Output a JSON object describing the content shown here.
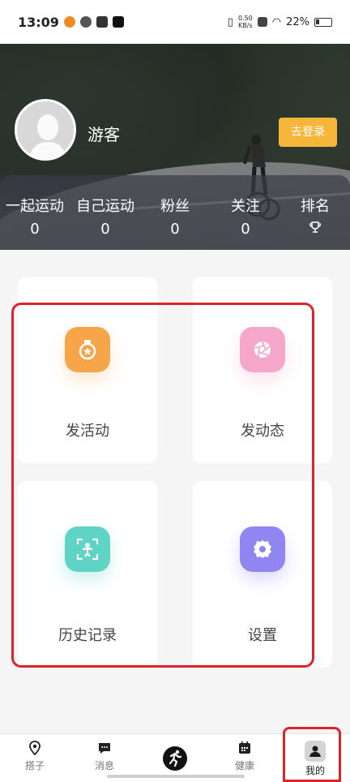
{
  "status_bar": {
    "time": "13:09",
    "net_speed_value": "0.50",
    "net_speed_unit": "KB/s",
    "battery": "22%"
  },
  "profile": {
    "username": "游客",
    "login_button": "去登录"
  },
  "stats": [
    {
      "label": "一起运动",
      "value": "0"
    },
    {
      "label": "自己运动",
      "value": "0"
    },
    {
      "label": "粉丝",
      "value": "0"
    },
    {
      "label": "关注",
      "value": "0"
    },
    {
      "label": "排名",
      "value": ""
    }
  ],
  "cards": [
    {
      "label": "发活动",
      "icon": "medal-icon",
      "color": "#f7a54a"
    },
    {
      "label": "发动态",
      "icon": "aperture-icon",
      "color": "#f4a7c8"
    },
    {
      "label": "历史记录",
      "icon": "person-scan-icon",
      "color": "#5ed3c6"
    },
    {
      "label": "设置",
      "icon": "gear-icon",
      "color": "#8f86f2"
    }
  ],
  "nav": [
    {
      "label": "搭子",
      "icon": "location-pin-icon"
    },
    {
      "label": "消息",
      "icon": "chat-bubble-icon"
    },
    {
      "label": "",
      "icon": "running-icon"
    },
    {
      "label": "健康",
      "icon": "calendar-icon"
    },
    {
      "label": "我的",
      "icon": "user-icon",
      "active": true
    }
  ],
  "colors": {
    "accent": "#f5b63a",
    "highlight": "#d9252b",
    "active_nav": "#1c1c1c"
  }
}
